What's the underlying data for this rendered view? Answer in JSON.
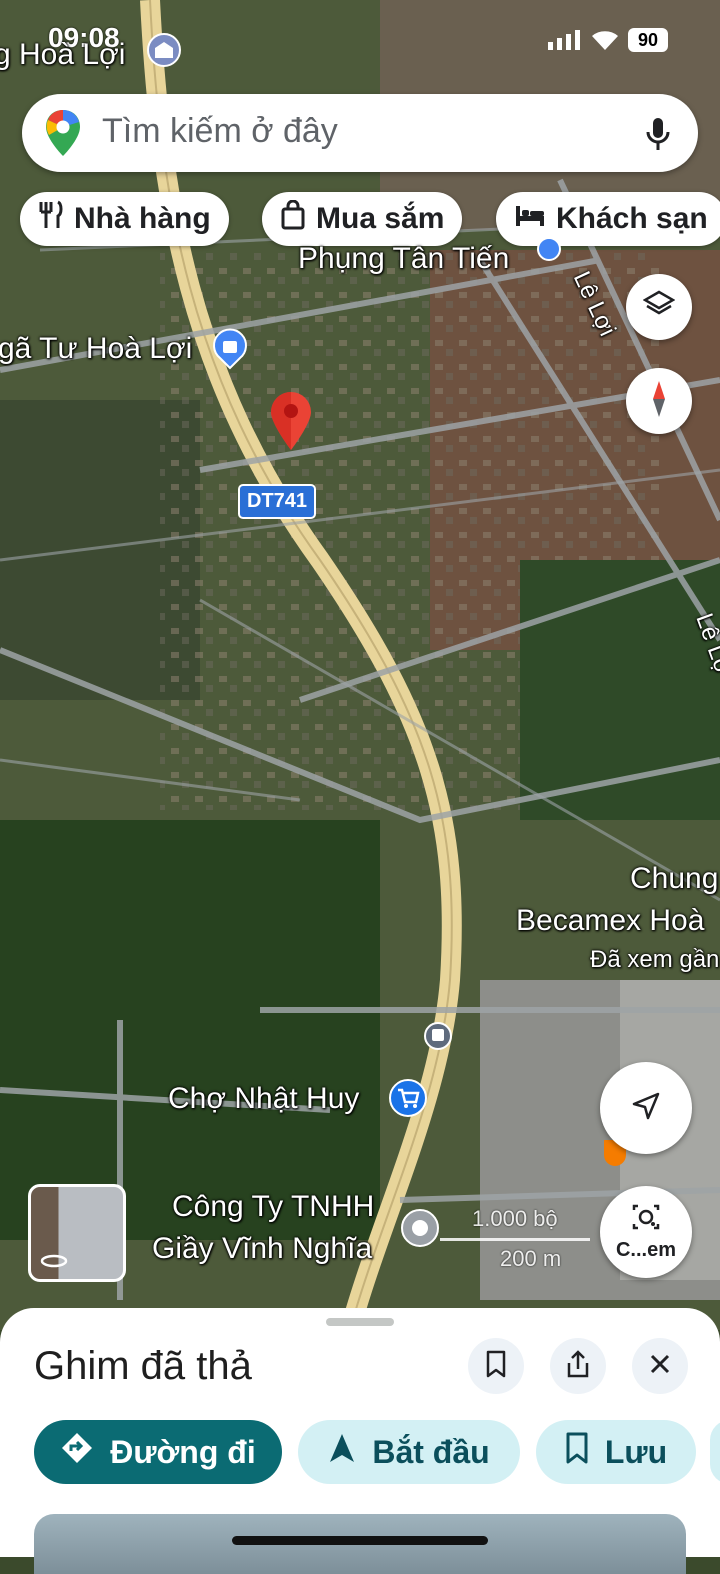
{
  "status_bar": {
    "time": "09:08",
    "battery": "90"
  },
  "search": {
    "placeholder": "Tìm kiếm ở đây"
  },
  "chips": [
    {
      "label": "Nhà hàng",
      "icon": "restaurant-icon"
    },
    {
      "label": "Mua sắm",
      "icon": "shopping-bag-icon"
    },
    {
      "label": "Khách sạn",
      "icon": "hotel-bed-icon"
    }
  ],
  "map_labels": {
    "hoa_loi_top": "g Hoà Lợi",
    "phung_tan_tien": "Phụng Tân Tiến",
    "nga_tu_hoa_loi": "gã Tư Hoà Lợi",
    "route": "DT741",
    "le_loi_1": "Lê Lợi",
    "le_loi_2": "Lê Lợ",
    "chung": "Chung",
    "becamex": "Becamex Hoà",
    "da_xem": "Đã xem gần",
    "cho_nhat_huy": "Chợ Nhật Huy",
    "cong_ty_1": "Công Ty TNHH",
    "cong_ty_2": "Giầy Vĩnh Nghĩa"
  },
  "scale": {
    "feet": "1.000 bộ",
    "meters": "200 m"
  },
  "camera_button": {
    "label": "C...em"
  },
  "sheet": {
    "title": "Ghim đã thả",
    "buttons": {
      "directions": "Đường đi",
      "start": "Bắt đầu",
      "save": "Lưu"
    }
  },
  "colors": {
    "primary": "#0b6b73",
    "secondary_bg": "#d3f0f4",
    "pin": "#ea4335",
    "road": "#e8d59a"
  }
}
